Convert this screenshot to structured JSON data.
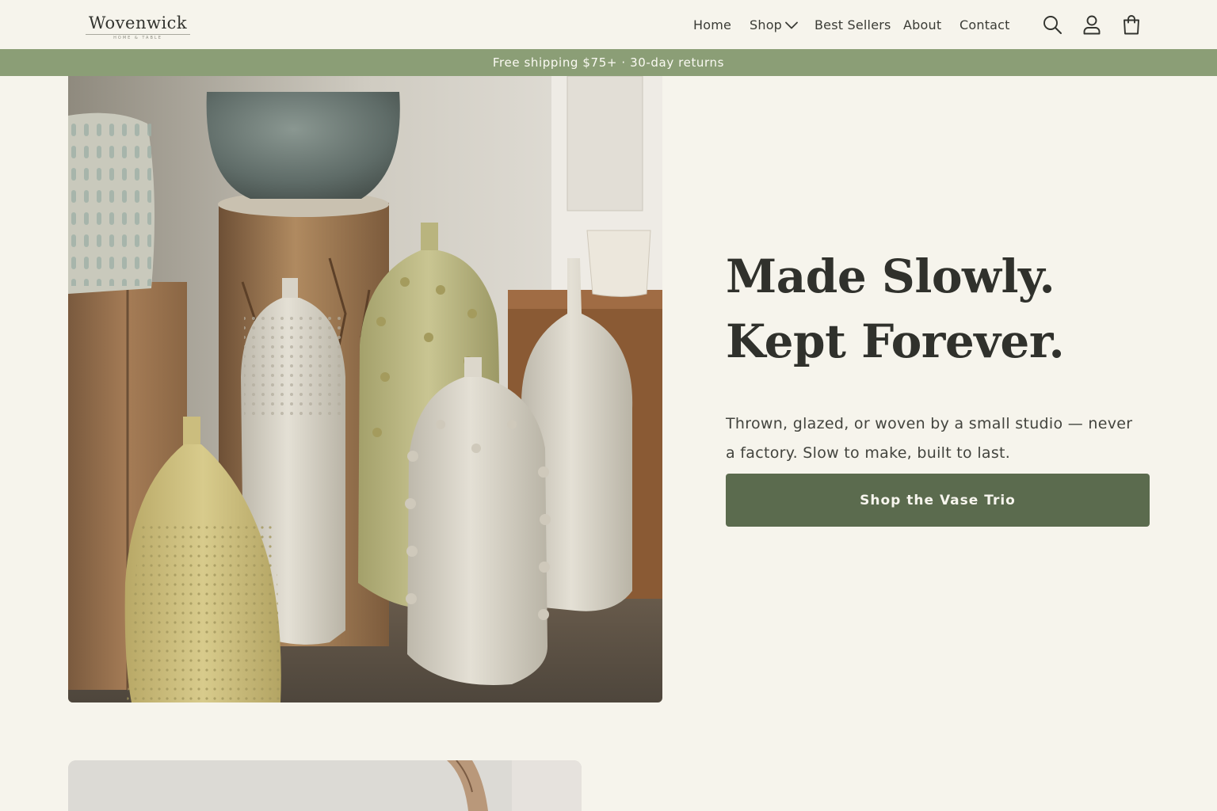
{
  "brand": {
    "name": "Wovenwick",
    "tagline": "HOME & TABLE"
  },
  "nav": {
    "items": [
      {
        "label": "Home"
      },
      {
        "label": "Shop",
        "has_dropdown": true
      },
      {
        "label": "Best Sellers"
      },
      {
        "label": "About"
      },
      {
        "label": "Contact"
      }
    ]
  },
  "header_icons": [
    "search-icon",
    "account-icon",
    "cart-icon"
  ],
  "announcement": "Free shipping $75+ · 30-day returns",
  "hero": {
    "image_alt": "ceramic vases",
    "headline_line1": "Made Slowly.",
    "headline_line2": "Kept Forever.",
    "subcopy": "Thrown, glazed, or woven by a small studio — never a factory. Slow to make, built to last.",
    "cta_label": "Shop the Vase Trio"
  },
  "colors": {
    "background": "#f6f4ec",
    "announcement_bar": "#8b9e76",
    "cta": "#5b6b4e",
    "text": "#30312c"
  }
}
